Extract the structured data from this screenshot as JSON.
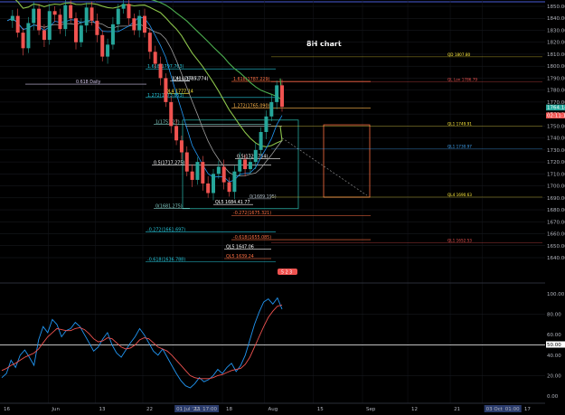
{
  "chart_data": [
    {
      "type": "candlestick",
      "title": "8H chart",
      "y_axis": {
        "ticks": [
          1850,
          1840,
          1830,
          1820,
          1810,
          1800,
          1790,
          1780,
          1770,
          1760,
          1750,
          1740,
          1730,
          1720,
          1710,
          1700,
          1690,
          1680,
          1670,
          1660,
          1650,
          1640
        ],
        "labels": [
          "1850.00",
          "1840.00",
          "1830.00",
          "1820.00",
          "1810.00",
          "1800.00",
          "1790.00",
          "1780.00",
          "1770.00",
          "1760.00",
          "1750.00",
          "1740.00",
          "1730.00",
          "1720.00",
          "1710.00",
          "1700.00",
          "1690.00",
          "1680.00",
          "1670.00",
          "1660.00",
          "1650.00",
          "1640.00"
        ],
        "price_badges": [
          {
            "value": 1764.14,
            "label": "1764.14",
            "color": "#26a69a"
          },
          {
            "value": 1762.0,
            "label": "02:11:13",
            "color": "#ef5350"
          }
        ]
      },
      "x_axis": {
        "labels": [
          "16",
          "Jun",
          "13",
          "22",
          "01 Jul '22",
          "17:00",
          "11",
          "18",
          "Aug",
          "15",
          "Sep",
          "12",
          "21",
          "03 Oct '22",
          "01:00",
          "17"
        ],
        "label_x": [
          0.0,
          0.0885,
          0.175,
          0.262,
          0.317,
          0.365,
          0.35,
          0.408,
          0.485,
          0.575,
          0.665,
          0.748,
          0.826,
          0.885,
          0.92,
          0.955
        ]
      },
      "fib_levels": [
        {
          "label": "1.618(1797.763)",
          "value": 1797.763,
          "color": "#26c6da"
        },
        {
          "label": "0.618 Daily",
          "value": 1785,
          "color": "#d1c4e9"
        },
        {
          "label": "QH 1787.52",
          "value": 1787.52,
          "color": "#b0bec5"
        },
        {
          "label": "1.414(1787.774)",
          "value": 1787.774,
          "color": "#ffffff"
        },
        {
          "label": "QL4 1777.14",
          "value": 1777.14,
          "color": "#ffeb3b"
        },
        {
          "label": "1.272(1773.853)",
          "value": 1773.853,
          "color": "#26c6da"
        },
        {
          "label": "1.618(1787.229)",
          "value": 1787.229,
          "color": "#ff7043"
        },
        {
          "label": "1.272(1765.090)",
          "value": 1765.09,
          "color": "#ffb74d"
        },
        {
          "label": "1(1751.27)",
          "value": 1751.27,
          "color": "#80cbc4"
        },
        {
          "label": "0.5(1717.275)",
          "value": 1717.275,
          "color": "#ffffff"
        },
        {
          "label": "0.5(1722.754)",
          "value": 1722.754,
          "color": "#ffffff"
        },
        {
          "label": "0(1689.195)",
          "value": 1689.195,
          "color": "#b0bec5"
        },
        {
          "label": "QL5 1684.41 77",
          "value": 1684.41,
          "color": "#ffffff"
        },
        {
          "label": "0(1681.275)",
          "value": 1681.275,
          "color": "#80cbc4"
        },
        {
          "label": "-0.272(1675.321)",
          "value": 1675.321,
          "color": "#ff7043"
        },
        {
          "label": "-0.272(1661.697)",
          "value": 1661.697,
          "color": "#26c6da"
        },
        {
          "label": "-0.618(1655.085)",
          "value": 1655.085,
          "color": "#ff7043"
        },
        {
          "label": "QL5 1647.06",
          "value": 1647.06,
          "color": "#ffffff"
        },
        {
          "label": "QL5 1639.24",
          "value": 1639.24,
          "color": "#ff7043"
        },
        {
          "label": "-0.618(1636.788)",
          "value": 1636.788,
          "color": "#26c6da"
        }
      ],
      "right_levels": [
        {
          "label": "QD 1807.80",
          "value": 1807.8,
          "color": "#ffeb3b"
        },
        {
          "label": "QL Lon 1786.79",
          "value": 1786.79,
          "color": "#ef5350"
        },
        {
          "label": "QL1 1749.91",
          "value": 1749.91,
          "color": "#ffeb3b"
        },
        {
          "label": "QL1 1730.97",
          "value": 1730.97,
          "color": "#42a5f5"
        },
        {
          "label": "QL4 1690.63",
          "value": 1690.63,
          "color": "#ffeb3b"
        },
        {
          "label": "QL1 1652.53",
          "value": 1652.53,
          "color": "#ef5350"
        }
      ],
      "badge": {
        "label": "5 2 3",
        "color": "#ef5350"
      },
      "moving_averages": [
        {
          "color": "#4caf50"
        },
        {
          "color": "#8bc34a"
        },
        {
          "color": "#9e9e9e"
        },
        {
          "color": "#2196f3"
        }
      ],
      "price_path": [
        1838,
        1842,
        1828,
        1815,
        1836,
        1848,
        1830,
        1822,
        1846,
        1843,
        1831,
        1851,
        1840,
        1820,
        1834,
        1849,
        1838,
        1826,
        1808,
        1818,
        1835,
        1848,
        1852,
        1840,
        1830,
        1842,
        1828,
        1812,
        1802,
        1790,
        1770,
        1750,
        1738,
        1728,
        1712,
        1705,
        1720,
        1702,
        1694,
        1710,
        1716,
        1703,
        1695,
        1712,
        1722,
        1714,
        1720,
        1730,
        1745,
        1758,
        1770,
        1784,
        1766
      ]
    },
    {
      "type": "line",
      "title": "",
      "y_axis": {
        "ticks": [
          100,
          80,
          60,
          50,
          40,
          20,
          0
        ],
        "labels": [
          "100.00",
          "80.00",
          "60.00",
          "50.00",
          "40.00",
          "20.00",
          "0.00"
        ],
        "highlight": {
          "value": 50,
          "label": "50.00"
        }
      },
      "series": [
        {
          "color": "#2196f3",
          "values": [
            18,
            22,
            35,
            28,
            40,
            45,
            38,
            30,
            55,
            68,
            62,
            75,
            70,
            58,
            64,
            66,
            72,
            68,
            60,
            52,
            44,
            48,
            56,
            62,
            50,
            42,
            38,
            45,
            52,
            58,
            66,
            60,
            52,
            44,
            40,
            46,
            38,
            30,
            22,
            15,
            10,
            8,
            12,
            18,
            14,
            16,
            20,
            26,
            22,
            28,
            32,
            24,
            30,
            40,
            55,
            70,
            82,
            92,
            95,
            90,
            96,
            85
          ]
        },
        {
          "color": "#ef5350",
          "values": [
            25,
            27,
            30,
            32,
            35,
            38,
            40,
            42,
            46,
            52,
            58,
            62,
            66,
            65,
            64,
            64,
            66,
            67,
            65,
            61,
            56,
            53,
            54,
            57,
            56,
            52,
            48,
            46,
            47,
            50,
            55,
            57,
            56,
            52,
            48,
            46,
            44,
            40,
            35,
            30,
            25,
            20,
            18,
            17,
            17,
            17,
            18,
            20,
            21,
            23,
            25,
            26,
            27,
            31,
            38,
            48,
            58,
            68,
            77,
            83,
            88,
            89
          ]
        }
      ]
    }
  ]
}
